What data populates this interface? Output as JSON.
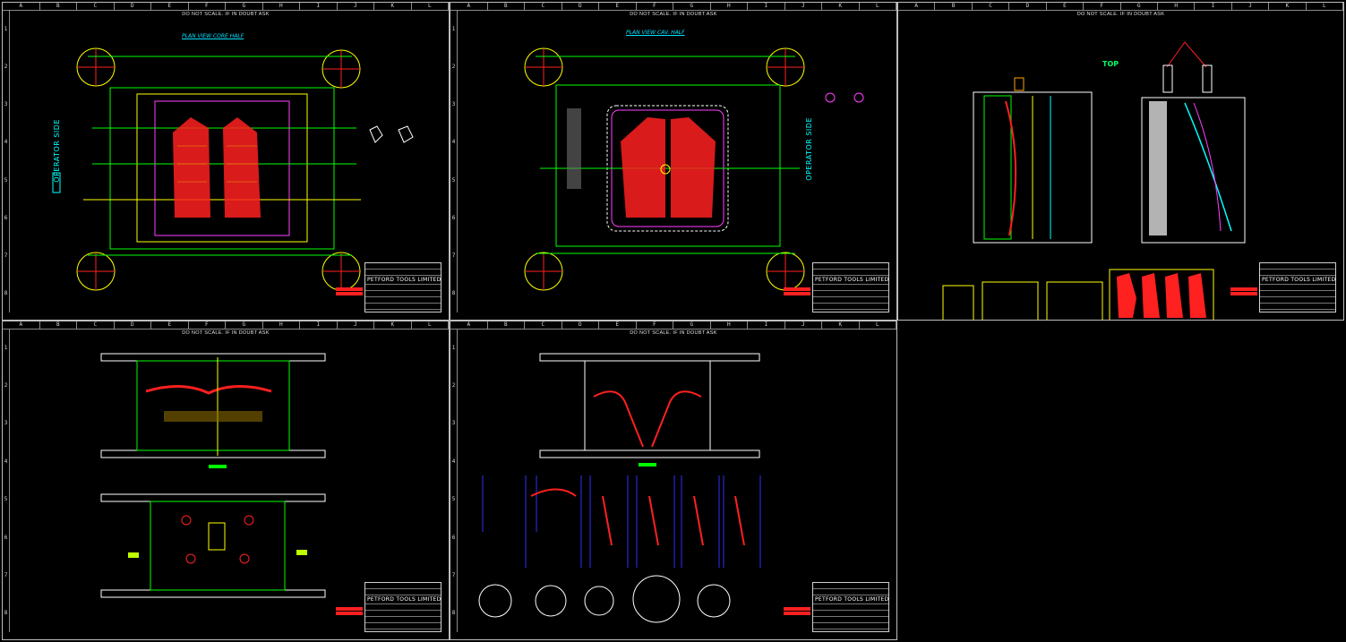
{
  "sheet_note": "DO NOT SCALE. IF IN DOUBT ASK",
  "column_letters": [
    "A",
    "B",
    "C",
    "D",
    "E",
    "F",
    "G",
    "H",
    "I",
    "J",
    "K",
    "L"
  ],
  "row_numbers_top": [
    "1",
    "2",
    "3",
    "4",
    "5",
    "6",
    "7",
    "8"
  ],
  "row_numbers_bottom": [
    "1",
    "2",
    "3",
    "4",
    "5",
    "6",
    "7",
    "8"
  ],
  "sheet1": {
    "view_title": "PLAN VIEW CORE HALF",
    "operator_side": "OPERATOR SIDE"
  },
  "sheet2": {
    "view_title": "PLAN VIEW CAV. HALF",
    "operator_side": "OPERATOR SIDE"
  },
  "sheet3": {
    "top_label": "TOP"
  },
  "title_block": {
    "company": "PETFORD TOOLS LIMITED"
  },
  "colors": {
    "sheet_border": "#bdbdbd",
    "part_red": "#ff2020",
    "cyan": "#00ffff",
    "green": "#00ff00",
    "yellow": "#ffff00",
    "magenta": "#ff40ff"
  }
}
